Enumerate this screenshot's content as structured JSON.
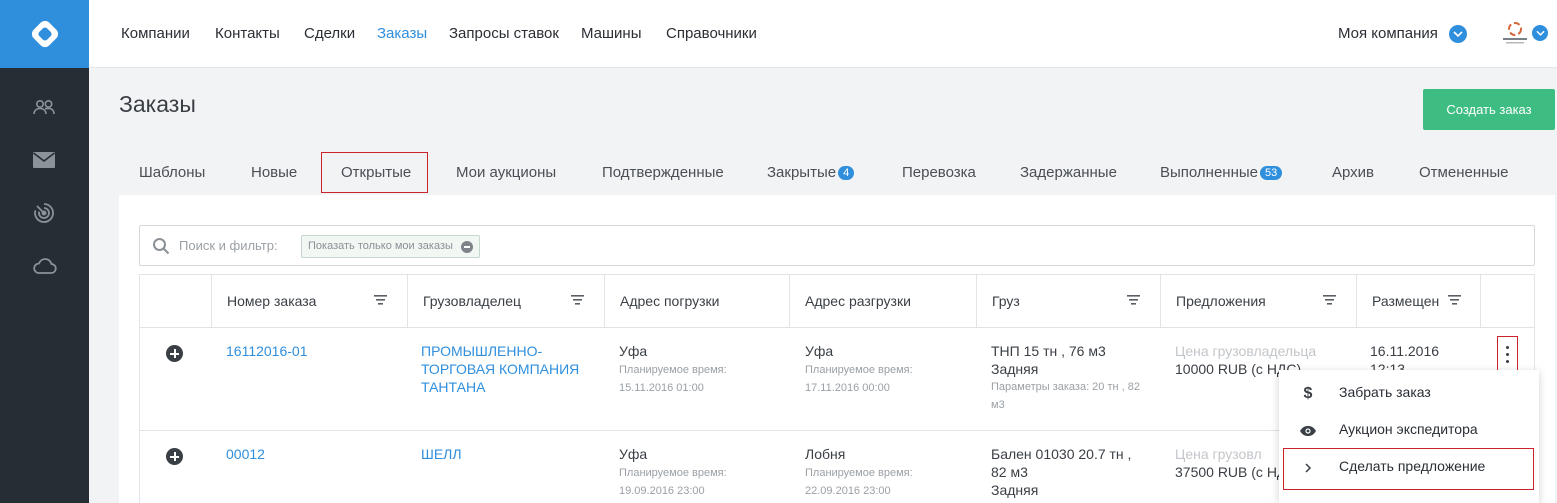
{
  "nav": {
    "items": [
      "Компании",
      "Контакты",
      "Сделки",
      "Заказы",
      "Запросы ставок",
      "Машины",
      "Справочники"
    ],
    "active": "Заказы",
    "company": "Моя компания"
  },
  "sidebar": {
    "icons": [
      "users-icon",
      "mail-icon",
      "radar-icon",
      "cloud-icon"
    ]
  },
  "page": {
    "title": "Заказы",
    "create_button": "Создать заказ"
  },
  "tabs": [
    {
      "label": "Шаблоны"
    },
    {
      "label": "Новые"
    },
    {
      "label": "Открытые",
      "selected": true
    },
    {
      "label": "Мои аукционы"
    },
    {
      "label": "Подтвержденные"
    },
    {
      "label": "Закрытые",
      "badge": "4"
    },
    {
      "label": "Перевозка"
    },
    {
      "label": "Задержанные"
    },
    {
      "label": "Выполненные",
      "badge": "53"
    },
    {
      "label": "Архив"
    },
    {
      "label": "Отмененные"
    }
  ],
  "search": {
    "placeholder": "Поиск и фильтр:",
    "chip": "Показать только мои заказы"
  },
  "table": {
    "columns": [
      "Номер заказа",
      "Грузовладелец",
      "Адрес погрузки",
      "Адрес разгрузки",
      "Груз",
      "Предложения",
      "Размещен"
    ],
    "rows": [
      {
        "order": "16112016-01",
        "owner_lines": [
          "ПРОМЫШЛЕННО-",
          "ТОРГОВАЯ КОМПАНИЯ",
          "ТАНТАНА"
        ],
        "load_city": "Уфа",
        "load_time_label": "Планируемое время:",
        "load_time": "15.11.2016 01:00",
        "unload_city": "Уфа",
        "unload_time_label": "Планируемое время:",
        "unload_time": "17.11.2016 00:00",
        "cargo_lines": [
          "ТНП 15 тн , 76 м3",
          "Задняя"
        ],
        "cargo_params_lines": [
          "Параметры заказа: 20 тн , 82",
          "м3"
        ],
        "offer_label": "Цена грузовладельца",
        "offer_value": "10000 RUB (с НДС)",
        "placed_date": "16.11.2016",
        "placed_time": "12:13"
      },
      {
        "order": "00012",
        "owner_lines": [
          "ШЕЛЛ"
        ],
        "load_city": "Уфа",
        "load_time_label": "Планируемое время:",
        "load_time": "19.09.2016 23:00",
        "unload_city": "Лобня",
        "unload_time_label": "Планируемое время:",
        "unload_time": "22.09.2016 23:00",
        "cargo_lines": [
          "Бален 01030 20.7 тн ,",
          "82 м3",
          "Задняя"
        ],
        "offer_label": "Цена грузовл",
        "offer_value": "37500 RUB (с НД"
      }
    ]
  },
  "menu": {
    "items": [
      {
        "icon": "dollar-icon",
        "label": "Забрать заказ"
      },
      {
        "icon": "eye-icon",
        "label": "Аукцион экспедитора"
      },
      {
        "icon": "chevron-right-icon",
        "label": "Сделать предложение"
      }
    ]
  },
  "colors": {
    "accent": "#2f8fdd",
    "sidebar": "#262d34",
    "create_button": "#3ebd82",
    "highlight_box": "#c9242c"
  }
}
